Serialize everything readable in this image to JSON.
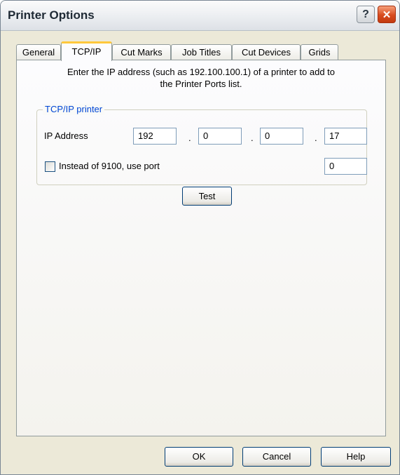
{
  "window": {
    "title": "Printer Options",
    "help_glyph": "?",
    "close_glyph": "✕"
  },
  "tabs": [
    {
      "label": "General"
    },
    {
      "label": "TCP/IP"
    },
    {
      "label": "Cut Marks"
    },
    {
      "label": "Job Titles"
    },
    {
      "label": "Cut Devices"
    },
    {
      "label": "Grids"
    }
  ],
  "active_tab": "TCP/IP",
  "panel": {
    "instruction_line1": "Enter the IP address (such as 192.100.100.1) of a printer to add to",
    "instruction_line2": "the Printer Ports list.",
    "group_title": "TCP/IP printer",
    "ip_label": "IP Address",
    "ip_octets": [
      "192",
      "0",
      "0",
      "17"
    ],
    "octet_separator": ".",
    "port_checkbox_label": "Instead of 9100, use port",
    "port_checkbox_checked": false,
    "port_value": "0",
    "test_button": "Test"
  },
  "footer": {
    "ok_button": "OK",
    "cancel_button": "Cancel",
    "help_button": "Help"
  },
  "colors": {
    "group_title": "#0046d5",
    "active_tab_accent": "#ffc83c",
    "close_button": "#d84b1e"
  }
}
